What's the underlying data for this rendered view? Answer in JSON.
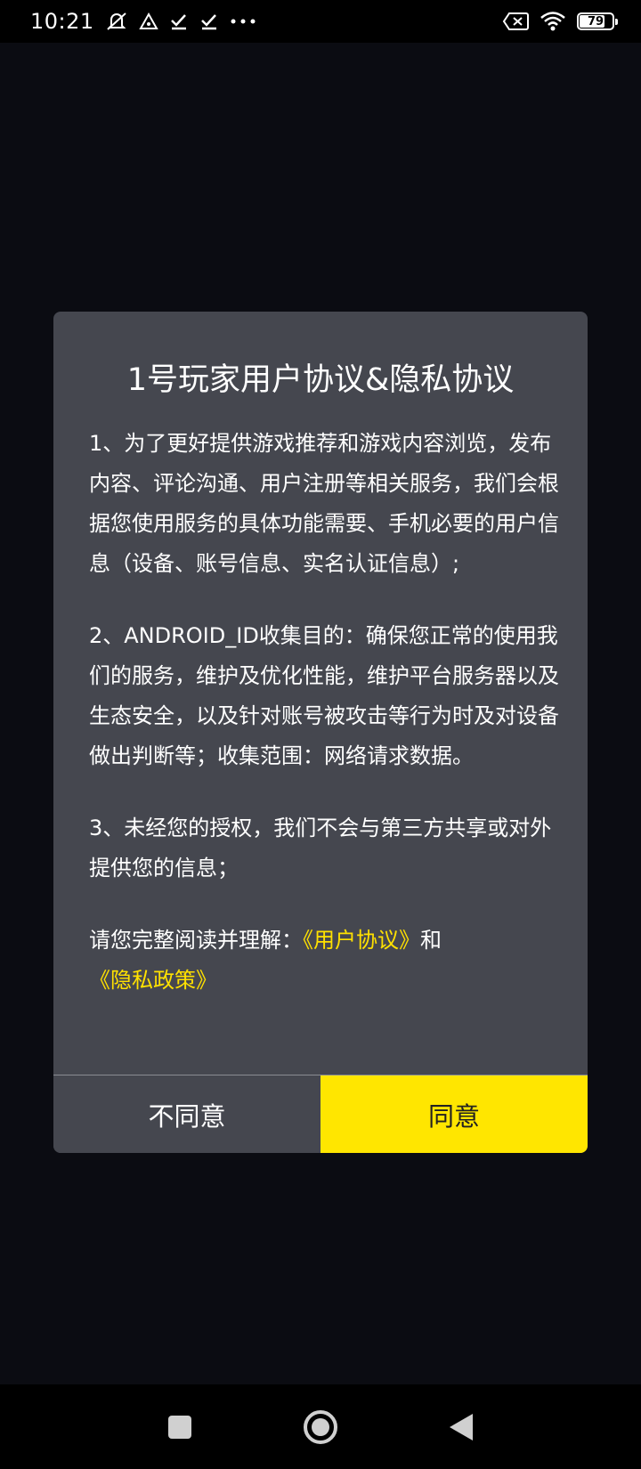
{
  "status_bar": {
    "time": "10:21",
    "icons_left": [
      "notification-muted-icon",
      "warning-triangle-icon",
      "check-download-icon",
      "check-download-icon",
      "more-dots-icon"
    ],
    "icons_right": [
      "sim-off-icon",
      "wifi-icon",
      "battery-icon"
    ],
    "battery_level": "79",
    "battery_percent": 79
  },
  "dialog": {
    "title": "1号玩家用户协议&隐私协议",
    "paragraphs": {
      "p1": "1、为了更好提供游戏推荐和游戏内容浏览，发布内容、评论沟通、用户注册等相关服务，我们会根据您使用服务的具体功能需要、手机必要的用户信息（设备、账号信息、实名认证信息）;",
      "p2": "2、ANDROID_ID收集目的：确保您正常的使用我们的服务，维护及优化性能，维护平台服务器以及生态安全，以及针对账号被攻击等行为时及对设备做出判断等；收集范围：网络请求数据。",
      "p3": "3、未经您的授权，我们不会与第三方共享或对外提供您的信息；"
    },
    "consent": {
      "prefix": "请您完整阅读并理解：",
      "user_agreement_link": "《用户协议》",
      "conjunction": "和",
      "privacy_policy_link": "《隐私政策》"
    },
    "buttons": {
      "disagree": "不同意",
      "agree": "同意"
    },
    "colors": {
      "background": "#45474f",
      "link": "#ffe100",
      "agree_button": "#ffe600"
    }
  },
  "nav_bar": {
    "buttons": [
      "recents-square-icon",
      "home-circle-icon",
      "back-triangle-icon"
    ]
  }
}
